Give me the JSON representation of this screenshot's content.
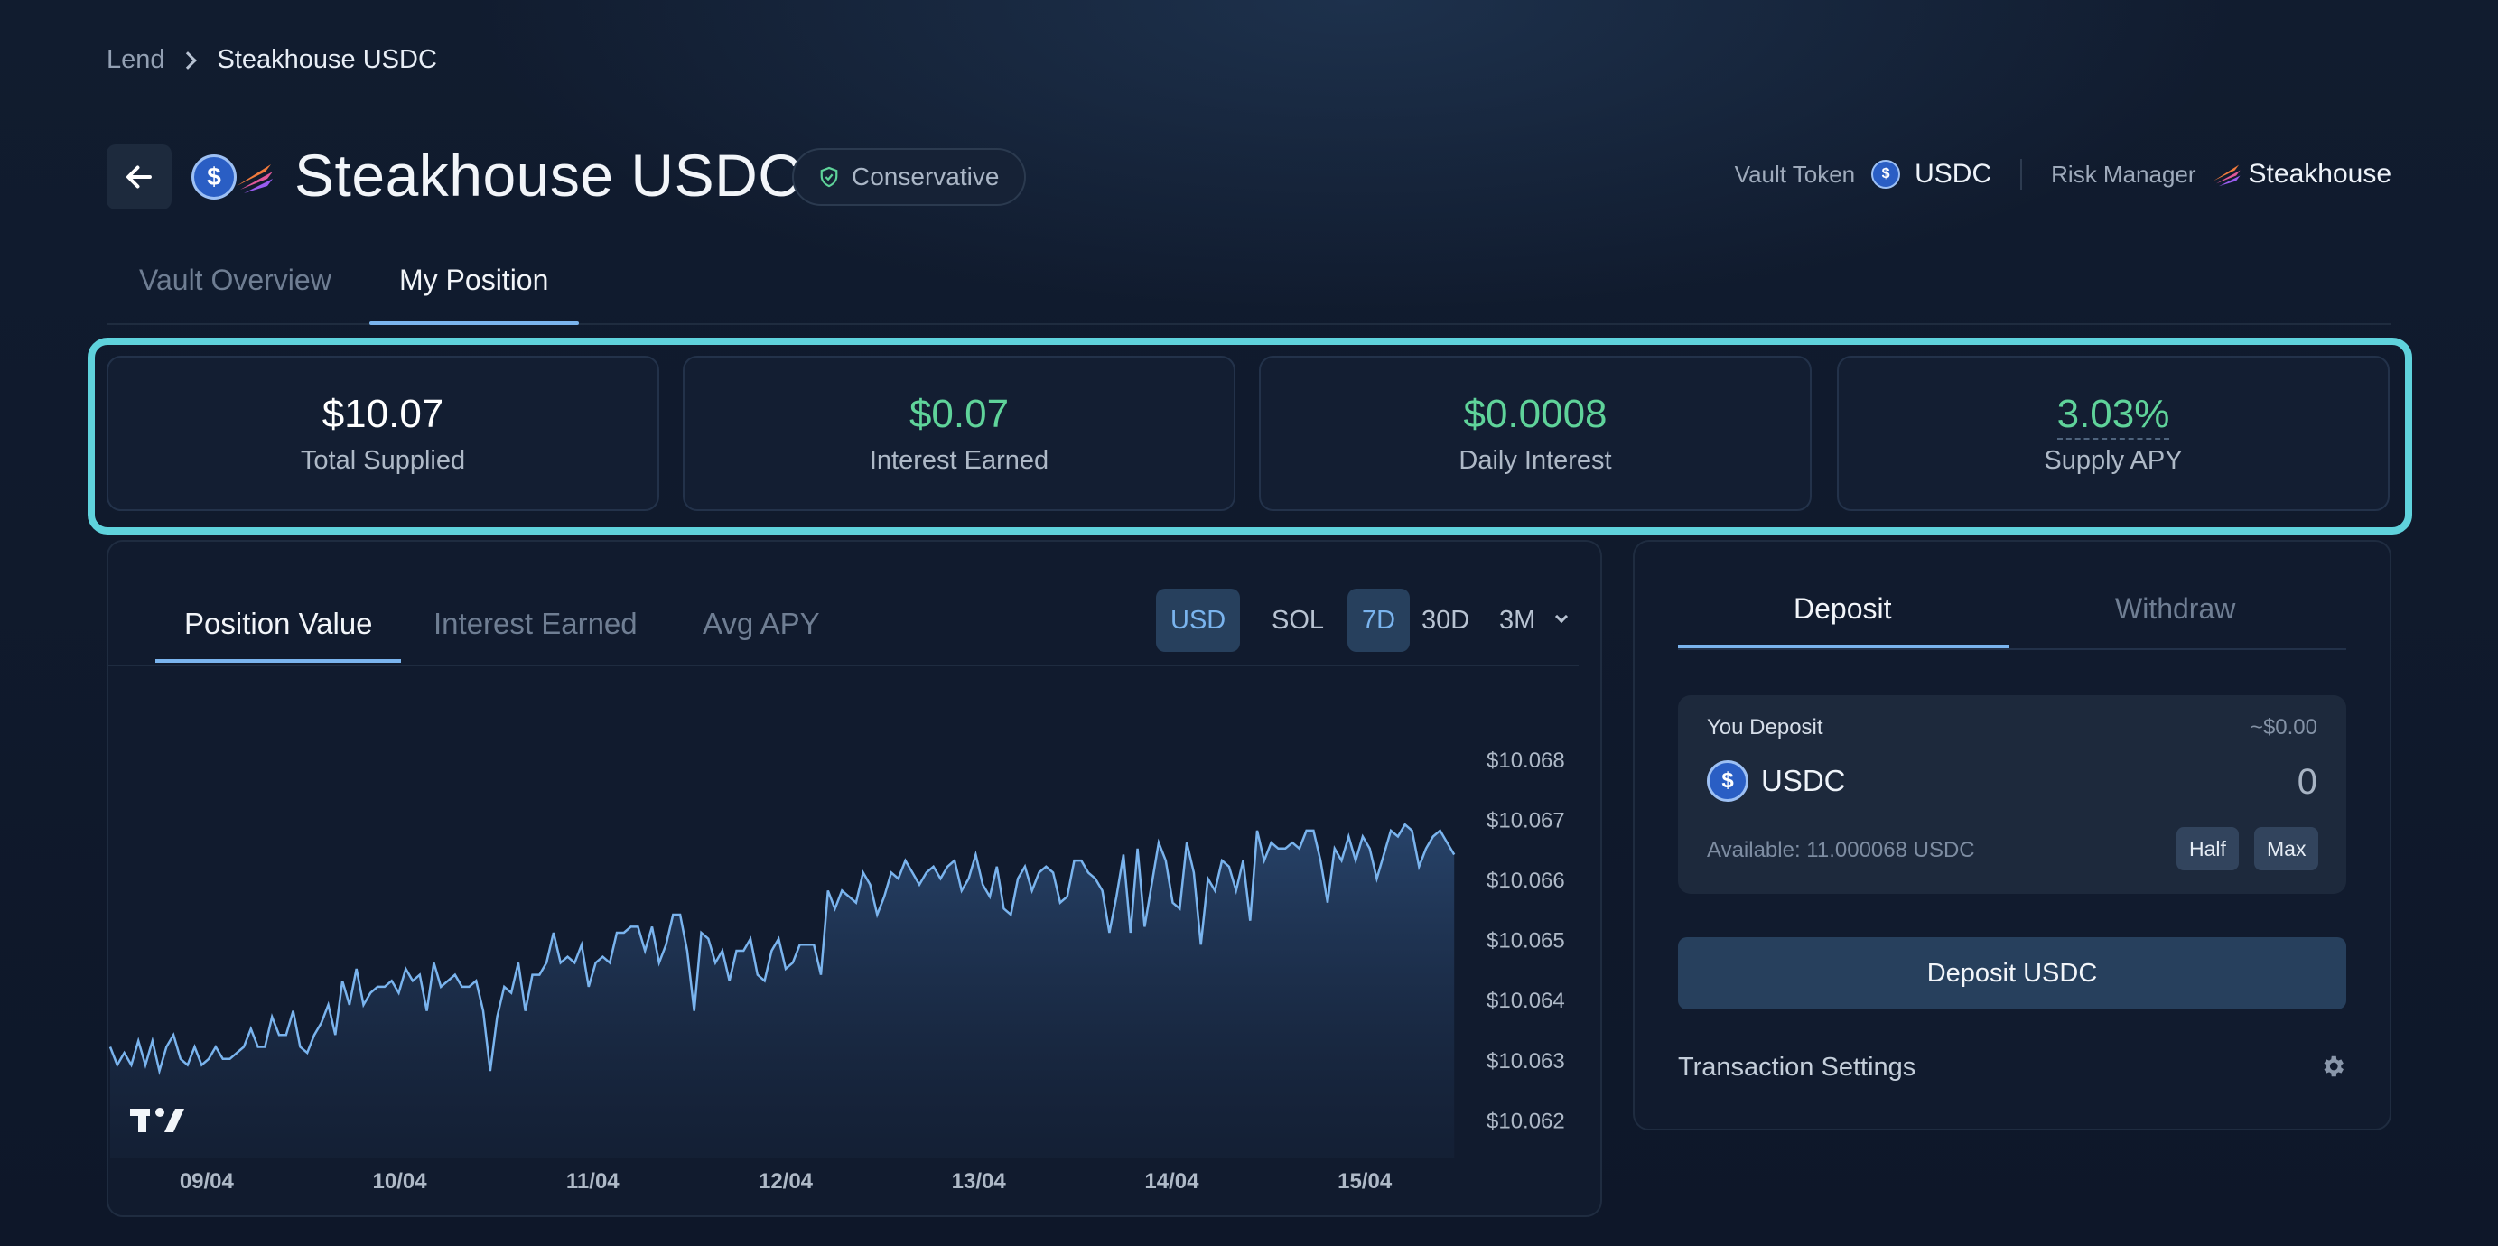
{
  "breadcrumb": {
    "parent": "Lend",
    "current": "Steakhouse USDC"
  },
  "header": {
    "title": "Steakhouse USDC",
    "risk_label": "Conservative",
    "vault_token_label": "Vault Token",
    "vault_token_value": "USDC",
    "risk_manager_label": "Risk Manager",
    "risk_manager_value": "Steakhouse"
  },
  "tabs": [
    {
      "label": "Vault Overview",
      "active": false
    },
    {
      "label": "My Position",
      "active": true
    }
  ],
  "stats": [
    {
      "value": "$10.07",
      "label": "Total Supplied",
      "color": "#ffffff"
    },
    {
      "value": "$0.07",
      "label": "Interest Earned",
      "color": "#5fd39a"
    },
    {
      "value": "$0.0008",
      "label": "Daily Interest",
      "color": "#5fd39a"
    },
    {
      "value": "3.03%",
      "label": "Supply APY",
      "color": "#5fd39a"
    }
  ],
  "chart_tabs": [
    "Position Value",
    "Interest Earned",
    "Avg APY"
  ],
  "currency_toggle": [
    "USD",
    "SOL"
  ],
  "range_toggle": [
    "7D",
    "30D",
    "3M"
  ],
  "chart_data": {
    "type": "area",
    "title": "",
    "xlabel": "",
    "ylabel": "",
    "x_ticks": [
      "09/04",
      "10/04",
      "11/04",
      "12/04",
      "13/04",
      "14/04",
      "15/04"
    ],
    "y_ticks": [
      "$10.068",
      "$10.067",
      "$10.066",
      "$10.065",
      "$10.064",
      "$10.063",
      "$10.062"
    ],
    "ylim": [
      10.0616,
      10.0683
    ],
    "xlim": [
      0,
      7
    ],
    "series": [
      {
        "values": [
          10.0632,
          10.0629,
          10.0631,
          10.0629,
          10.0633,
          10.0629,
          10.0633,
          10.0628,
          10.0632,
          10.0634,
          10.063,
          10.0629,
          10.0632,
          10.0629,
          10.063,
          10.0632,
          10.063,
          10.063,
          10.0631,
          10.0632,
          10.0635,
          10.0632,
          10.0632,
          10.0637,
          10.0634,
          10.0634,
          10.0638,
          10.0632,
          10.0631,
          10.0634,
          10.0636,
          10.0639,
          10.0634,
          10.0643,
          10.0639,
          10.0645,
          10.0639,
          10.0641,
          10.0642,
          10.0642,
          10.0643,
          10.0641,
          10.0645,
          10.0643,
          10.0644,
          10.0638,
          10.0646,
          10.0642,
          10.0643,
          10.0644,
          10.0642,
          10.0642,
          10.0643,
          10.0638,
          10.0628,
          10.0637,
          10.0642,
          10.0641,
          10.0646,
          10.0638,
          10.0644,
          10.0644,
          10.0646,
          10.0651,
          10.0646,
          10.0647,
          10.0646,
          10.0649,
          10.0642,
          10.0646,
          10.0647,
          10.0646,
          10.0651,
          10.0651,
          10.0652,
          10.0652,
          10.0648,
          10.0652,
          10.0646,
          10.0649,
          10.0654,
          10.0654,
          10.0648,
          10.0638,
          10.0651,
          10.065,
          10.0646,
          10.0648,
          10.0643,
          10.0648,
          10.0648,
          10.065,
          10.0644,
          10.0643,
          10.0648,
          10.065,
          10.0645,
          10.0646,
          10.0649,
          10.0649,
          10.0649,
          10.0644,
          10.0658,
          10.0655,
          10.0658,
          10.0657,
          10.0656,
          10.0661,
          10.0659,
          10.0654,
          10.0657,
          10.0661,
          10.066,
          10.0663,
          10.0661,
          10.0659,
          10.0661,
          10.0662,
          10.066,
          10.0662,
          10.0663,
          10.0658,
          10.066,
          10.0664,
          10.0659,
          10.0657,
          10.0662,
          10.0655,
          10.0654,
          10.066,
          10.0662,
          10.0658,
          10.0661,
          10.0662,
          10.0661,
          10.0656,
          10.0657,
          10.0663,
          10.0663,
          10.0661,
          10.066,
          10.0658,
          10.0651,
          10.0657,
          10.0664,
          10.0651,
          10.0665,
          10.0652,
          10.0659,
          10.0666,
          10.0663,
          10.0656,
          10.0655,
          10.0666,
          10.0661,
          10.0649,
          10.066,
          10.0658,
          10.0663,
          10.0662,
          10.0658,
          10.0663,
          10.0653,
          10.0668,
          10.0663,
          10.0666,
          10.0665,
          10.0665,
          10.0666,
          10.0665,
          10.0668,
          10.0668,
          10.0663,
          10.0656,
          10.0665,
          10.0663,
          10.0667,
          10.0663,
          10.0667,
          10.0665,
          10.066,
          10.0664,
          10.0668,
          10.0667,
          10.0669,
          10.0668,
          10.0662,
          10.0665,
          10.0667,
          10.0668,
          10.0666,
          10.0664
        ]
      }
    ],
    "grid": false,
    "legend": "none"
  },
  "deposit": {
    "tabs": [
      "Deposit",
      "Withdraw"
    ],
    "input_label": "You Deposit",
    "usd_value": "~$0.00",
    "token": "USDC",
    "amount": "0",
    "available": "Available: 11.000068 USDC",
    "half_label": "Half",
    "max_label": "Max",
    "submit_label": "Deposit USDC",
    "settings_label": "Transaction Settings"
  },
  "colors": {
    "accent": "#7ab4ee",
    "positive": "#5fd39a",
    "highlight_frame": "#5fd2dc",
    "background": "#0f172a"
  }
}
